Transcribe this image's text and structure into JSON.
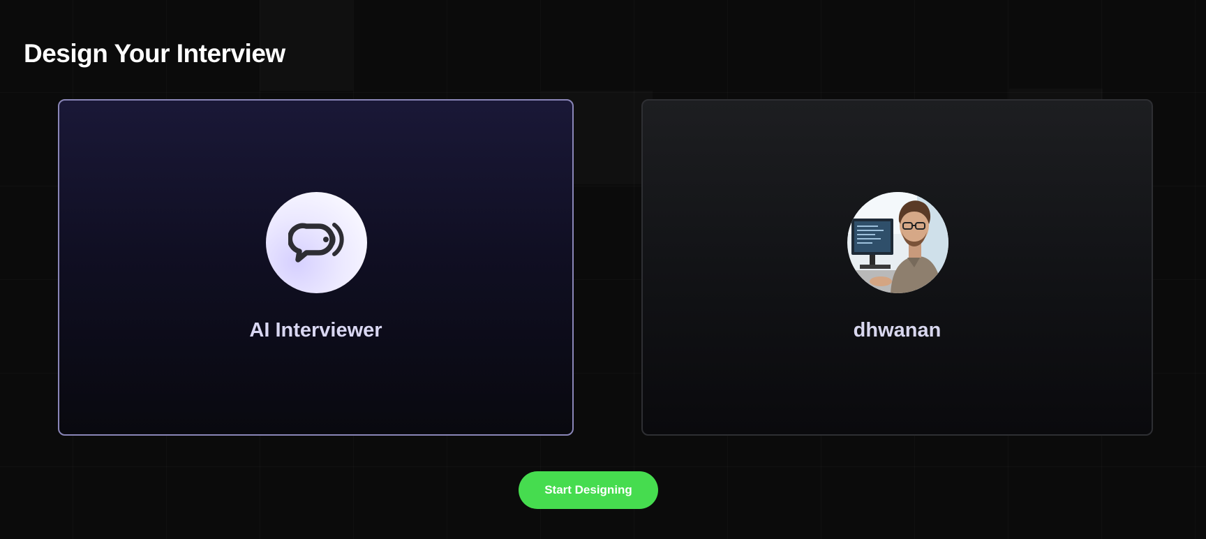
{
  "page": {
    "title": "Design Your Interview"
  },
  "cards": [
    {
      "label": "AI Interviewer",
      "icon": "chat-voice-icon",
      "selected": true
    },
    {
      "label": "dhwanan",
      "icon": "user-photo",
      "selected": false
    }
  ],
  "actions": {
    "start_label": "Start Designing"
  },
  "colors": {
    "accent_green": "#46dc4f",
    "selected_border": "#8a86b8",
    "background": "#0b0b0b"
  }
}
